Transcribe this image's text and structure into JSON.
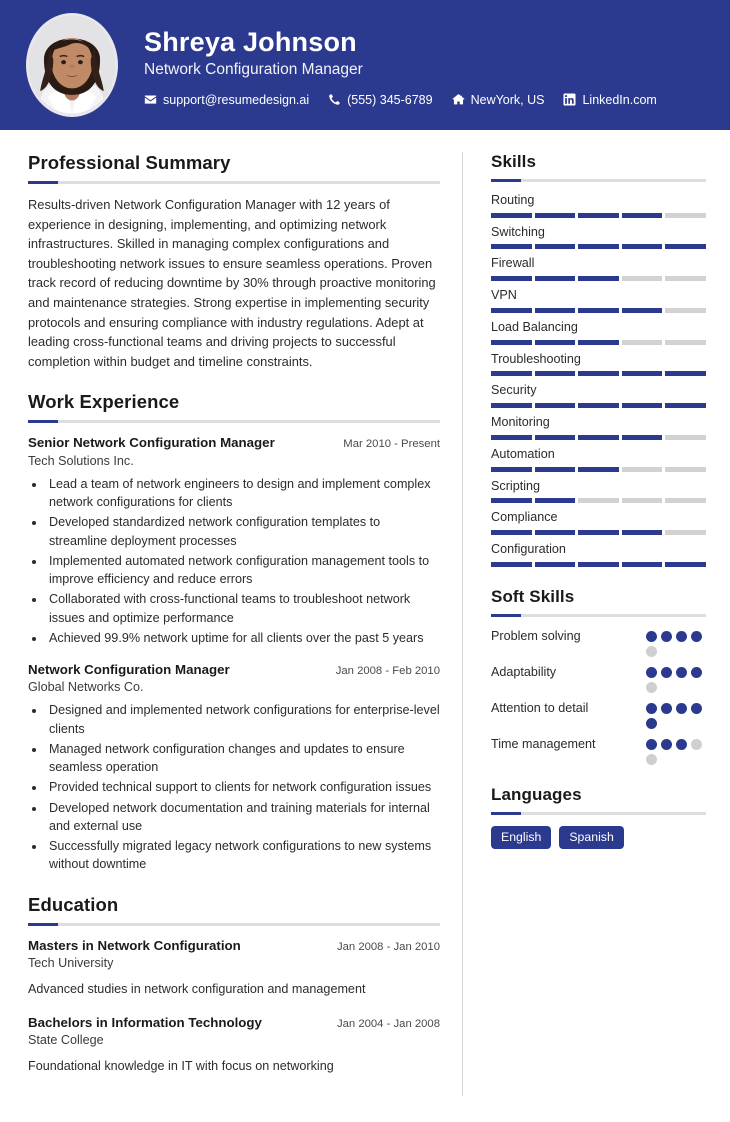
{
  "header": {
    "name": "Shreya Johnson",
    "title": "Network Configuration Manager",
    "accent_color": "#2B3A8F",
    "contacts": [
      {
        "icon": "envelope-icon",
        "text": "support@resumedesign.ai"
      },
      {
        "icon": "phone-icon",
        "text": "(555) 345-6789"
      },
      {
        "icon": "home-icon",
        "text": "NewYork, US"
      },
      {
        "icon": "linkedin-icon",
        "text": "LinkedIn.com"
      }
    ]
  },
  "main": {
    "summary": {
      "heading": "Professional Summary",
      "text": "Results-driven Network Configuration Manager with 12 years of experience in designing, implementing, and optimizing network infrastructures. Skilled in managing complex configurations and troubleshooting network issues to ensure seamless operations. Proven track record of reducing downtime by 30% through proactive monitoring and maintenance strategies. Strong expertise in implementing security protocols and ensuring compliance with industry regulations. Adept at leading cross-functional teams and driving projects to successful completion within budget and timeline constraints."
    },
    "experience": {
      "heading": "Work Experience",
      "entries": [
        {
          "role": "Senior Network Configuration Manager",
          "date": "Mar 2010 - Present",
          "org": "Tech Solutions Inc.",
          "bullets": [
            "Lead a team of network engineers to design and implement complex network configurations for clients",
            "Developed standardized network configuration templates to streamline deployment processes",
            "Implemented automated network configuration management tools to improve efficiency and reduce errors",
            "Collaborated with cross-functional teams to troubleshoot network issues and optimize performance",
            "Achieved 99.9% network uptime for all clients over the past 5 years"
          ]
        },
        {
          "role": "Network Configuration Manager",
          "date": "Jan 2008 - Feb 2010",
          "org": "Global Networks Co.",
          "bullets": [
            "Designed and implemented network configurations for enterprise-level clients",
            "Managed network configuration changes and updates to ensure seamless operation",
            "Provided technical support to clients for network configuration issues",
            "Developed network documentation and training materials for internal and external use",
            "Successfully migrated legacy network configurations to new systems without downtime"
          ]
        }
      ]
    },
    "education": {
      "heading": "Education",
      "entries": [
        {
          "degree": "Masters in Network Configuration",
          "date": "Jan 2008 - Jan 2010",
          "school": "Tech University",
          "description": "Advanced studies in network configuration and management"
        },
        {
          "degree": "Bachelors in Information Technology",
          "date": "Jan 2004 - Jan 2008",
          "school": "State College",
          "description": "Foundational knowledge in IT with focus on networking"
        }
      ]
    }
  },
  "sidebar": {
    "skills": {
      "heading": "Skills",
      "max_level": 5,
      "items": [
        {
          "name": "Routing",
          "level": 4
        },
        {
          "name": "Switching",
          "level": 5
        },
        {
          "name": "Firewall",
          "level": 3
        },
        {
          "name": "VPN",
          "level": 4
        },
        {
          "name": "Load Balancing",
          "level": 3
        },
        {
          "name": "Troubleshooting",
          "level": 5
        },
        {
          "name": "Security",
          "level": 5
        },
        {
          "name": "Monitoring",
          "level": 4
        },
        {
          "name": "Automation",
          "level": 3
        },
        {
          "name": "Scripting",
          "level": 2
        },
        {
          "name": "Compliance",
          "level": 4
        },
        {
          "name": "Configuration",
          "level": 5
        }
      ]
    },
    "soft_skills": {
      "heading": "Soft Skills",
      "max_level": 5,
      "items": [
        {
          "name": "Problem solving",
          "level": 4
        },
        {
          "name": "Adaptability",
          "level": 4
        },
        {
          "name": "Attention to detail",
          "level": 5
        },
        {
          "name": "Time management",
          "level": 3
        }
      ]
    },
    "languages": {
      "heading": "Languages",
      "items": [
        "English",
        "Spanish"
      ]
    }
  }
}
